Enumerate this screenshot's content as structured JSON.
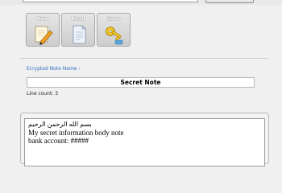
{
  "toolbar": {
    "new_label": "New",
    "read_label": "Read",
    "save_label": "Save"
  },
  "note": {
    "section_label": "Ecrypted Note Name :",
    "name": "Secret Note",
    "line_count": "Line count:  3",
    "body_lines": [
      "بسم الله الرحمن الرحيم",
      "My secret information body note",
      "bank account: #####"
    ]
  },
  "icons": {
    "new": "pencil-note-icon",
    "read": "document-icon",
    "save": "key-icon"
  }
}
